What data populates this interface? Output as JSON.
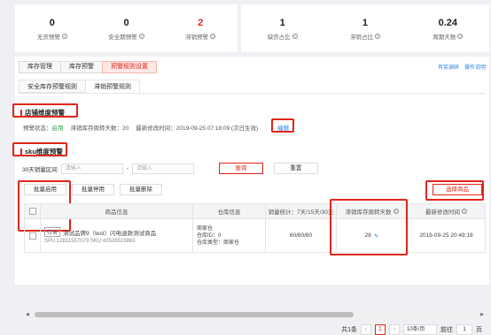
{
  "stats": [
    {
      "value": "0",
      "label": "无货预警",
      "red": false
    },
    {
      "value": "0",
      "label": "安全期预警",
      "red": false
    },
    {
      "value": "2",
      "label": "滞销预警",
      "red": true
    },
    {
      "value": "1",
      "label": "缺货占比",
      "red": false
    },
    {
      "value": "1",
      "label": "滞销占比",
      "red": false
    },
    {
      "value": "0.24",
      "label": "周期天数",
      "red": false
    }
  ],
  "tabs_main": [
    "库存管理",
    "库存预警",
    "预警规则设置"
  ],
  "help_links": [
    "有奖调研",
    "操作说明"
  ],
  "tabs_sub": [
    "安全库存预警规则",
    "滞销预警规则"
  ],
  "store_section": {
    "title": "店铺维度预警",
    "status_label": "预警状态：",
    "status_value": "启用",
    "turnover": "滞销库存周转天数：20",
    "modified": "最新修改时间：2019-09-25 07:18:09 (次日生效)",
    "edit": "编辑"
  },
  "sku_section": {
    "title": "sku维度预警",
    "range_label": "30天销量区间",
    "input_placeholder": "请输入",
    "search": "查询",
    "reset": "重置"
  },
  "batch_buttons": [
    "批量启用",
    "批量停用",
    "批量删除"
  ],
  "select_goods": "选择商品",
  "table": {
    "headers": [
      "商品信息",
      "仓库信息",
      "销量统计：7天/15天/30天",
      "滞销库存周转天数",
      "最新修改时间"
    ],
    "rows": [
      {
        "tag": "待售",
        "name": "测试品牌9（test）闪电退款测试商品",
        "sku": "SPU:12811557073  SKU:43528519863",
        "warehouse": [
          "商家仓",
          "仓库ID：0",
          "仓库类型：商家仓"
        ],
        "sales": "60/60/60",
        "turnover": "26",
        "edit_icon": "✎",
        "modified": "2019-09-25 20:49:18"
      }
    ]
  },
  "pager": {
    "total": "共1条",
    "prev": "‹",
    "current": "1",
    "next": "›",
    "size": "10条/页",
    "goto": "前往",
    "page_input": "1",
    "page_suffix": "页"
  },
  "colors": {
    "accent": "#e0251b",
    "link": "#2d7fe0",
    "green": "#2ea44f"
  }
}
